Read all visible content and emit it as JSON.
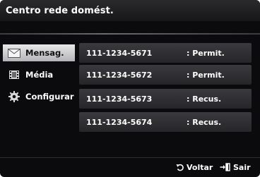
{
  "window": {
    "title": "Centro rede domést."
  },
  "sidebar": {
    "items": [
      {
        "label": "Mensag.",
        "icon": "envelope-icon",
        "selected": true
      },
      {
        "label": "Média",
        "icon": "film-icon",
        "selected": false
      },
      {
        "label": "Configurar",
        "icon": "gear-icon",
        "selected": false
      }
    ]
  },
  "devices": [
    {
      "number": "111-1234-5671",
      "status": ": Permit."
    },
    {
      "number": "111-1234-5672",
      "status": ": Permit."
    },
    {
      "number": "111-1234-5673",
      "status": ": Recus."
    },
    {
      "number": "111-1234-5674",
      "status": ": Recus."
    }
  ],
  "footer": {
    "back_label": "Voltar",
    "back_icon": "return-arrow-icon",
    "exit_label": "Sair",
    "exit_icon": "exit-icon"
  },
  "colors": {
    "selected_bg": "#d0d0d4",
    "row_bg": "#303034",
    "window_bg": "#0b0b0d"
  }
}
